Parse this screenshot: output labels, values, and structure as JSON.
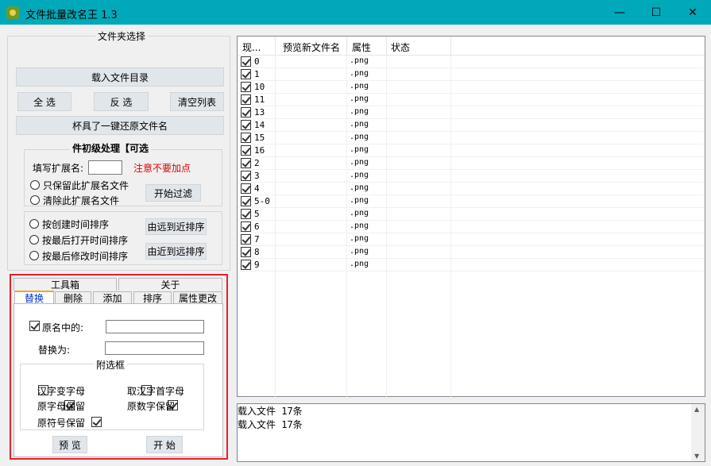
{
  "window": {
    "title": "文件批量改名王  1.3",
    "minimize": "—",
    "maximize": "☐",
    "close": "✕"
  },
  "folder": {
    "group_label": "文件夹选择",
    "load_button": "载入文件目录",
    "select_all": "全 选",
    "invert": "反 选",
    "clear_list": "清空列表",
    "restore": "杯具了一键还原文件名"
  },
  "ext_filter": {
    "group_label": "件初级处理【可选",
    "ext_label": "填写扩展名:",
    "ext_value": "",
    "note": "注意不要加点",
    "keep_option": "只保留此扩展名文件",
    "remove_option": "清除此扩展名文件",
    "start_filter": "开始过滤"
  },
  "sort": {
    "by_created": "按创建时间排序",
    "by_opened": "按最后打开时间排序",
    "by_modified": "按最后修改时间排序",
    "far_to_near": "由远到近排序",
    "near_to_far": "由近到远排序"
  },
  "tabs": {
    "outer": [
      "工具箱",
      "关于"
    ],
    "inner": [
      "替换",
      "删除",
      "添加",
      "排序",
      "属性更改"
    ]
  },
  "replace": {
    "original_label": "原名中的:",
    "original_value": "",
    "replace_label": "替换为:",
    "replace_value": "",
    "options_label": "附选框",
    "opt_hanzi_to_letter": "汉字变字母",
    "opt_hanzi_initial": "取汉字首字母",
    "opt_keep_letters": "原字母保留",
    "opt_keep_digits": "原数字保留",
    "opt_keep_symbols": "原符号保留",
    "preview": "预 览",
    "start": "开 始"
  },
  "list": {
    "columns": [
      "现...",
      "预览新文件名",
      "属性",
      "状态"
    ],
    "rows": [
      {
        "name": "0",
        "ext": ".png"
      },
      {
        "name": "1",
        "ext": ".png"
      },
      {
        "name": "10",
        "ext": ".png"
      },
      {
        "name": "11",
        "ext": ".png"
      },
      {
        "name": "13",
        "ext": ".png"
      },
      {
        "name": "14",
        "ext": ".png"
      },
      {
        "name": "15",
        "ext": ".png"
      },
      {
        "name": "16",
        "ext": ".png"
      },
      {
        "name": "2",
        "ext": ".png"
      },
      {
        "name": "3",
        "ext": ".png"
      },
      {
        "name": "4",
        "ext": ".png"
      },
      {
        "name": "5-0",
        "ext": ".png"
      },
      {
        "name": "5",
        "ext": ".png"
      },
      {
        "name": "6",
        "ext": ".png"
      },
      {
        "name": "7",
        "ext": ".png"
      },
      {
        "name": "8",
        "ext": ".png"
      },
      {
        "name": "9",
        "ext": ".png"
      }
    ]
  },
  "log": {
    "lines": [
      "载入文件  17条",
      "载入文件  17条"
    ]
  }
}
